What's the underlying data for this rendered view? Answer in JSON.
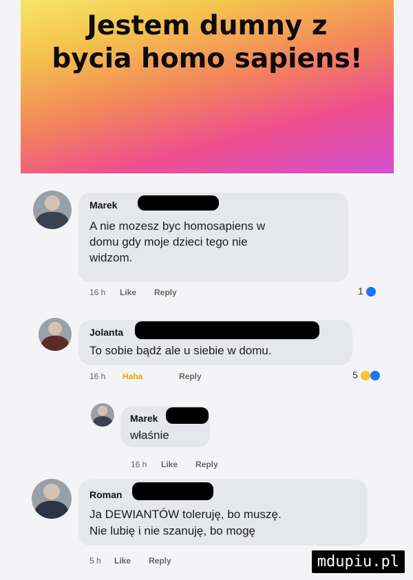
{
  "banner": {
    "line1": "Jestem dumny z",
    "line2": "bycia homo sapiens!"
  },
  "comments": [
    {
      "name": "Marek",
      "text_lines": [
        "A nie mozesz byc homosapiens w",
        "domu gdy moje dzieci tego nie",
        "widzom."
      ],
      "time": "16 h",
      "actions": [
        "Like",
        "Reply"
      ],
      "reaction_count": "1"
    },
    {
      "name": "Jolanta",
      "text_lines": [
        "To sobie bądź ale u siebie w domu."
      ],
      "time": "16 h",
      "actions": [
        "Haha",
        "Reply"
      ],
      "reaction_count": "5"
    },
    {
      "name": "Marek",
      "text_lines": [
        "właśnie"
      ],
      "time": "16 h",
      "actions": [
        "Like",
        "Reply"
      ]
    },
    {
      "name": "Roman",
      "text_lines": [
        "Ja DEWIANTÓW toleruję, bo muszę.",
        "Nie lubię i nie szanuję, bo mogę"
      ],
      "time": "5 h",
      "actions": [
        "Like",
        "Reply"
      ]
    }
  ],
  "watermark": "mdupiu.pl",
  "colors": {
    "like_blue": "#1877f2",
    "haha_yellow": "#f7c531",
    "bubble": "#e6e7eb"
  }
}
